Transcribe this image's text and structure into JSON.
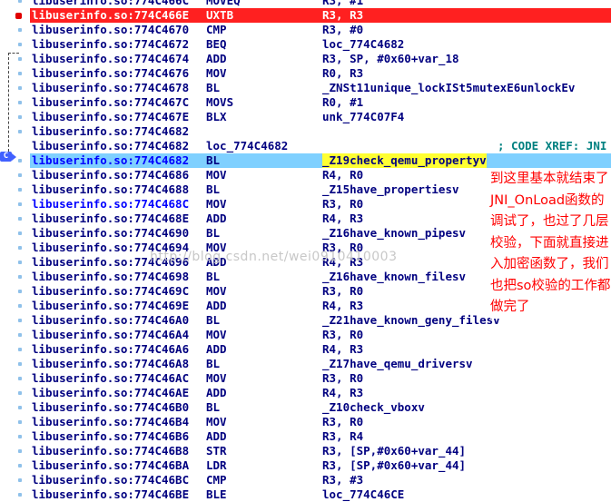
{
  "rows": [
    {
      "addr": "libuserinfo.so:774C466C",
      "mn": "MOVEQ",
      "op": "R3, #1"
    },
    {
      "addr": "libuserinfo.so:774C466E",
      "mn": "UXTB",
      "op": "R3, R3"
    },
    {
      "addr": "libuserinfo.so:774C4670",
      "mn": "CMP",
      "op": "R3, #0"
    },
    {
      "addr": "libuserinfo.so:774C4672",
      "mn": "BEQ",
      "op": "loc_774C4682"
    },
    {
      "addr": "libuserinfo.so:774C4674",
      "mn": "ADD",
      "op": "R3, SP, #0x60+var_18"
    },
    {
      "addr": "libuserinfo.so:774C4676",
      "mn": "MOV",
      "op": "R0, R3"
    },
    {
      "addr": "libuserinfo.so:774C4678",
      "mn": "BL",
      "op": "_ZNSt11unique_lockISt5mutexE6unlockEv"
    },
    {
      "addr": "libuserinfo.so:774C467C",
      "mn": "MOVS",
      "op": "R0, #1"
    },
    {
      "addr": "libuserinfo.so:774C467E",
      "mn": "BLX",
      "op": "unk_774C07F4"
    },
    {
      "addr": "libuserinfo.so:774C4682",
      "mn": "",
      "op": ""
    },
    {
      "addr": "libuserinfo.so:774C4682",
      "mn": "loc_774C4682",
      "op": "",
      "cm": "; CODE XREF: JNI"
    },
    {
      "addr": "libuserinfo.so:774C4682",
      "mn": "BL",
      "op": "_Z19check_qemu_propertyv"
    },
    {
      "addr": "libuserinfo.so:774C4686",
      "mn": "MOV",
      "op": "R4, R0"
    },
    {
      "addr": "libuserinfo.so:774C4688",
      "mn": "BL",
      "op": "_Z15have_propertiesv"
    },
    {
      "addr": "libuserinfo.so:774C468C",
      "mn": "MOV",
      "op": "R3, R0"
    },
    {
      "addr": "libuserinfo.so:774C468E",
      "mn": "ADD",
      "op": "R4, R3"
    },
    {
      "addr": "libuserinfo.so:774C4690",
      "mn": "BL",
      "op": "_Z16have_known_pipesv"
    },
    {
      "addr": "libuserinfo.so:774C4694",
      "mn": "MOV",
      "op": "R3, R0"
    },
    {
      "addr": "libuserinfo.so:774C4696",
      "mn": "ADD",
      "op": "R4, R3"
    },
    {
      "addr": "libuserinfo.so:774C4698",
      "mn": "BL",
      "op": "_Z16have_known_filesv"
    },
    {
      "addr": "libuserinfo.so:774C469C",
      "mn": "MOV",
      "op": "R3, R0"
    },
    {
      "addr": "libuserinfo.so:774C469E",
      "mn": "ADD",
      "op": "R4, R3"
    },
    {
      "addr": "libuserinfo.so:774C46A0",
      "mn": "BL",
      "op": "_Z21have_known_geny_filesv"
    },
    {
      "addr": "libuserinfo.so:774C46A4",
      "mn": "MOV",
      "op": "R3, R0"
    },
    {
      "addr": "libuserinfo.so:774C46A6",
      "mn": "ADD",
      "op": "R4, R3"
    },
    {
      "addr": "libuserinfo.so:774C46A8",
      "mn": "BL",
      "op": "_Z17have_qemu_driversv"
    },
    {
      "addr": "libuserinfo.so:774C46AC",
      "mn": "MOV",
      "op": "R3, R0"
    },
    {
      "addr": "libuserinfo.so:774C46AE",
      "mn": "ADD",
      "op": "R4, R3"
    },
    {
      "addr": "libuserinfo.so:774C46B0",
      "mn": "BL",
      "op": "_Z10check_vboxv"
    },
    {
      "addr": "libuserinfo.so:774C46B4",
      "mn": "MOV",
      "op": "R3, R0"
    },
    {
      "addr": "libuserinfo.so:774C46B6",
      "mn": "ADD",
      "op": "R3, R4"
    },
    {
      "addr": "libuserinfo.so:774C46B8",
      "mn": "STR",
      "op": "R3, [SP,#0x60+var_44]"
    },
    {
      "addr": "libuserinfo.so:774C46BA",
      "mn": "LDR",
      "op": "R3, [SP,#0x60+var_44]"
    },
    {
      "addr": "libuserinfo.so:774C46BC",
      "mn": "CMP",
      "op": "R3, #3"
    },
    {
      "addr": "libuserinfo.so:774C46BE",
      "mn": "BLE",
      "op": "loc_774C46CE"
    }
  ],
  "annotation": "到这里基本就结束了JNI_OnLoad函数的调试了，也过了几层校验，下面就直接进入加密函数了，我们也把so校验的工作都做完了",
  "watermark": "http://blog.csdn.net/wei0910410003",
  "xref_tag": "C",
  "colors": {
    "breakpoint": "#ff2020",
    "current_line": "#7fd0ff",
    "highlight": "#ffff33",
    "address": "#000080",
    "annotation": "#ff0000"
  }
}
